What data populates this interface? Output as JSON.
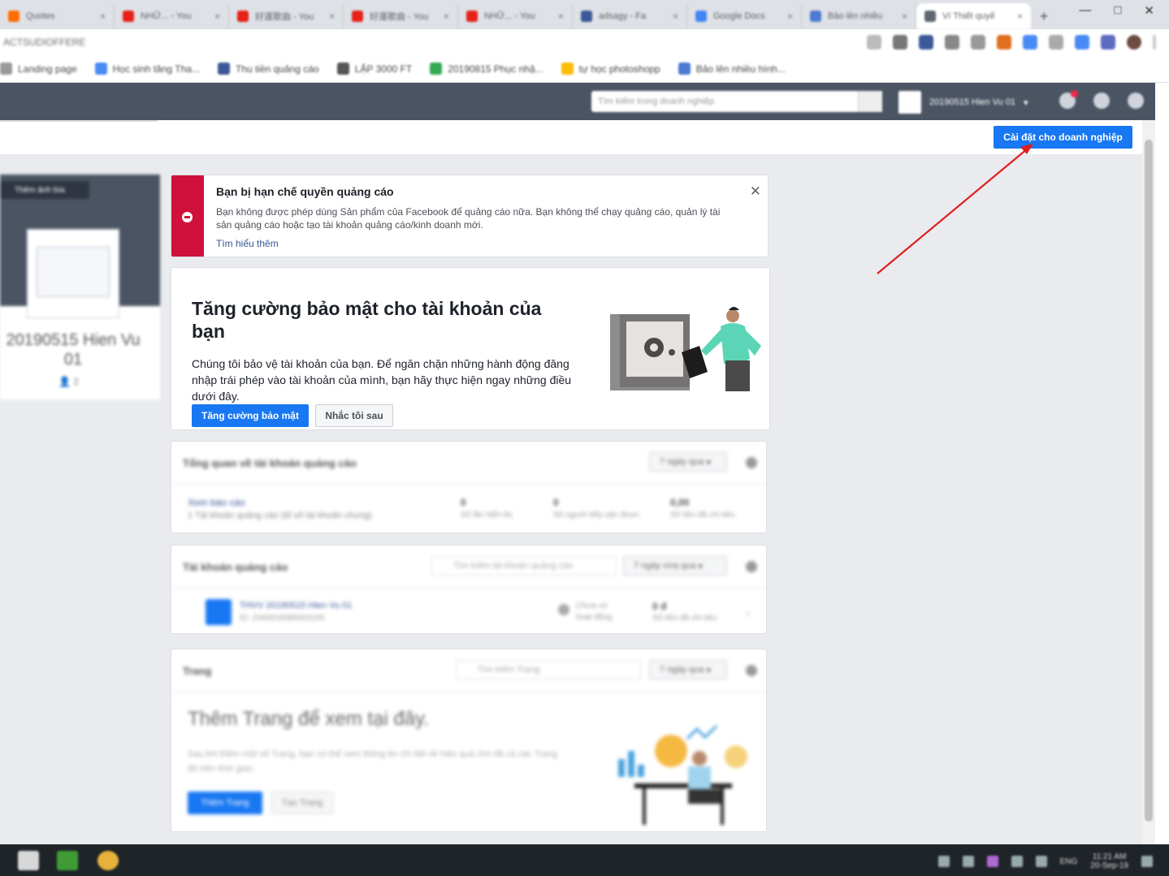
{
  "browser": {
    "tabs": [
      {
        "label": "Quotes",
        "color": "#ff6d00"
      },
      {
        "label": "NHỮ... - You",
        "color": "#e62117"
      },
      {
        "label": "好運歌曲 - You",
        "color": "#e62117"
      },
      {
        "label": "好運歌曲 - You",
        "color": "#e62117"
      },
      {
        "label": "NHỮ... - You",
        "color": "#e62117"
      },
      {
        "label": "adsagy - Fa",
        "color": "#3b5998"
      },
      {
        "label": "Google Docs",
        "color": "#4285f4"
      },
      {
        "label": "Bảo lên nhiều",
        "color": "#4e7ad1"
      },
      {
        "label": "Ví Thiết quyế",
        "color": "#606770"
      }
    ],
    "active_tab_index": 8,
    "url": "ACTSUDIOFFERE",
    "bookmarks": [
      {
        "label": "Landing page",
        "color": "#999"
      },
      {
        "label": "Học sinh tăng Tha...",
        "color": "#4a8af4"
      },
      {
        "label": "Thu tiền quảng cáo",
        "color": "#3b5998"
      },
      {
        "label": "LẬP 3000 FT",
        "color": "#555"
      },
      {
        "label": "20190815 Phục nhặ...",
        "color": "#34a853"
      },
      {
        "label": "tự học photoshopp",
        "color": "#fbbc05"
      },
      {
        "label": "Bảo lên nhiều hình...",
        "color": "#4e7ad1"
      }
    ]
  },
  "fb_header": {
    "search_placeholder": "Tìm kiếm trong doanh nghiệp",
    "account_name": "20190515 Hien Vu 01"
  },
  "subheader": {
    "business_settings_button": "Cài đặt cho doanh nghiệp"
  },
  "left_profile": {
    "cover_pill": "Thêm ảnh bìa",
    "name": "20190515 Hien Vu 01",
    "people_count": "2"
  },
  "alert": {
    "title": "Bạn bị hạn chế quyền quảng cáo",
    "body": "Bạn không được phép dùng Sản phẩm của Facebook để quảng cáo nữa. Bạn không thể chạy quảng cáo, quản lý tài sản quảng cáo hoặc tạo tài khoản quảng cáo/kinh doanh mới.",
    "learn_more": "Tìm hiểu thêm",
    "color": "#d0113b"
  },
  "security": {
    "title": "Tăng cường bảo mật cho tài khoản của bạn",
    "body": "Chúng tôi bảo vệ tài khoản của bạn. Để ngăn chặn những hành động đăng nhập trái phép vào tài khoản của mình, bạn hãy thực hiện ngay những điều dưới đây.",
    "primary_button": "Tăng cường bảo mật",
    "secondary_button": "Nhắc tôi sau"
  },
  "overview": {
    "title": "Tổng quan về tài khoản quảng cáo",
    "period": "7 ngày qua",
    "report_link": "Xem báo cáo",
    "report_desc": "1 Tài khoản quảng cáo (tổ số tài khoản chung)",
    "stats": [
      {
        "value": "0",
        "label": "Số lần hiển thị"
      },
      {
        "value": "0",
        "label": "Số người tiếp cận được"
      },
      {
        "value": "0,00",
        "label": "Số tiền đã chi tiêu"
      }
    ]
  },
  "ad_accounts": {
    "title": "Tài khoản quảng cáo",
    "search_placeholder": "Tìm kiếm tài khoản quảng cáo",
    "filter": "7 ngày vừa qua",
    "account_name": "THVV 20190515 Hien Vu 01",
    "account_id": "ID: 2440516085003105",
    "status": "Chưa có hoạt động",
    "spend": "0 đ",
    "spend_label": "Số tiền đã chi tiêu"
  },
  "pages": {
    "title": "Trang",
    "search_placeholder": "Tìm kiếm Trang",
    "filter": "7 ngày qua",
    "empty_title": "Thêm Trang để xem tại đây.",
    "empty_body": "Sau khi thêm một số Trang, bạn có thể xem thông tin chi tiết về hiệu quả cho tất cả các Trang đó trên thời gian.",
    "add_button": "Thêm Trang",
    "create_button": "Tạo Trang"
  },
  "taskbar": {
    "time": "11:21 AM",
    "date": "20-Sep-19",
    "lang": "ENG"
  }
}
